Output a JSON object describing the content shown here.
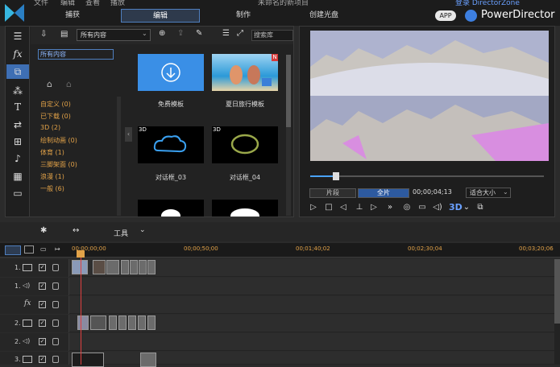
{
  "topbar": {
    "menus": [
      "文件",
      "编辑",
      "查看",
      "播放"
    ],
    "project_title": "未命名的新项目",
    "site": "登录 DirectorZone",
    "tabs": [
      "捕获",
      "编辑",
      "制作",
      "创建光盘"
    ],
    "app_badge": "APP",
    "app_name": "PowerDirector"
  },
  "library": {
    "dropdown": "所有内容",
    "search_placeholder": "搜索库",
    "category_header": "所有内容",
    "categories": [
      "自定义 (0)",
      "已下载 (0)",
      "3D (2)",
      "绘制动画 (0)",
      "体育 (1)",
      "三脚架面 (0)",
      "浪漫 (1)",
      "一般 (6)"
    ],
    "items": [
      {
        "label": "免费模板",
        "badge": ""
      },
      {
        "label": "夏日旅行模板",
        "badge": "N"
      },
      {
        "label": "对话框_03",
        "badge": "3D"
      },
      {
        "label": "对话框_04",
        "badge": "3D"
      }
    ]
  },
  "preview": {
    "clip_mode": "片段",
    "full_mode": "全片",
    "timecode": "00;00;04;13",
    "zoom": "适合大小",
    "stereo": "3D",
    "progress": 0.11
  },
  "tools": {
    "label": "工具"
  },
  "timeline": {
    "ticks": [
      "00;00;00;00",
      "00;00;50;00",
      "00;01;40;02",
      "00;02;30;04",
      "00;03;20;06"
    ],
    "tracks": [
      {
        "num": "1.",
        "kind": "video"
      },
      {
        "num": "1.",
        "kind": "audio"
      },
      {
        "num": "",
        "kind": "fx"
      },
      {
        "num": "2.",
        "kind": "video"
      },
      {
        "num": "2.",
        "kind": "audio"
      },
      {
        "num": "3.",
        "kind": "video"
      }
    ]
  }
}
